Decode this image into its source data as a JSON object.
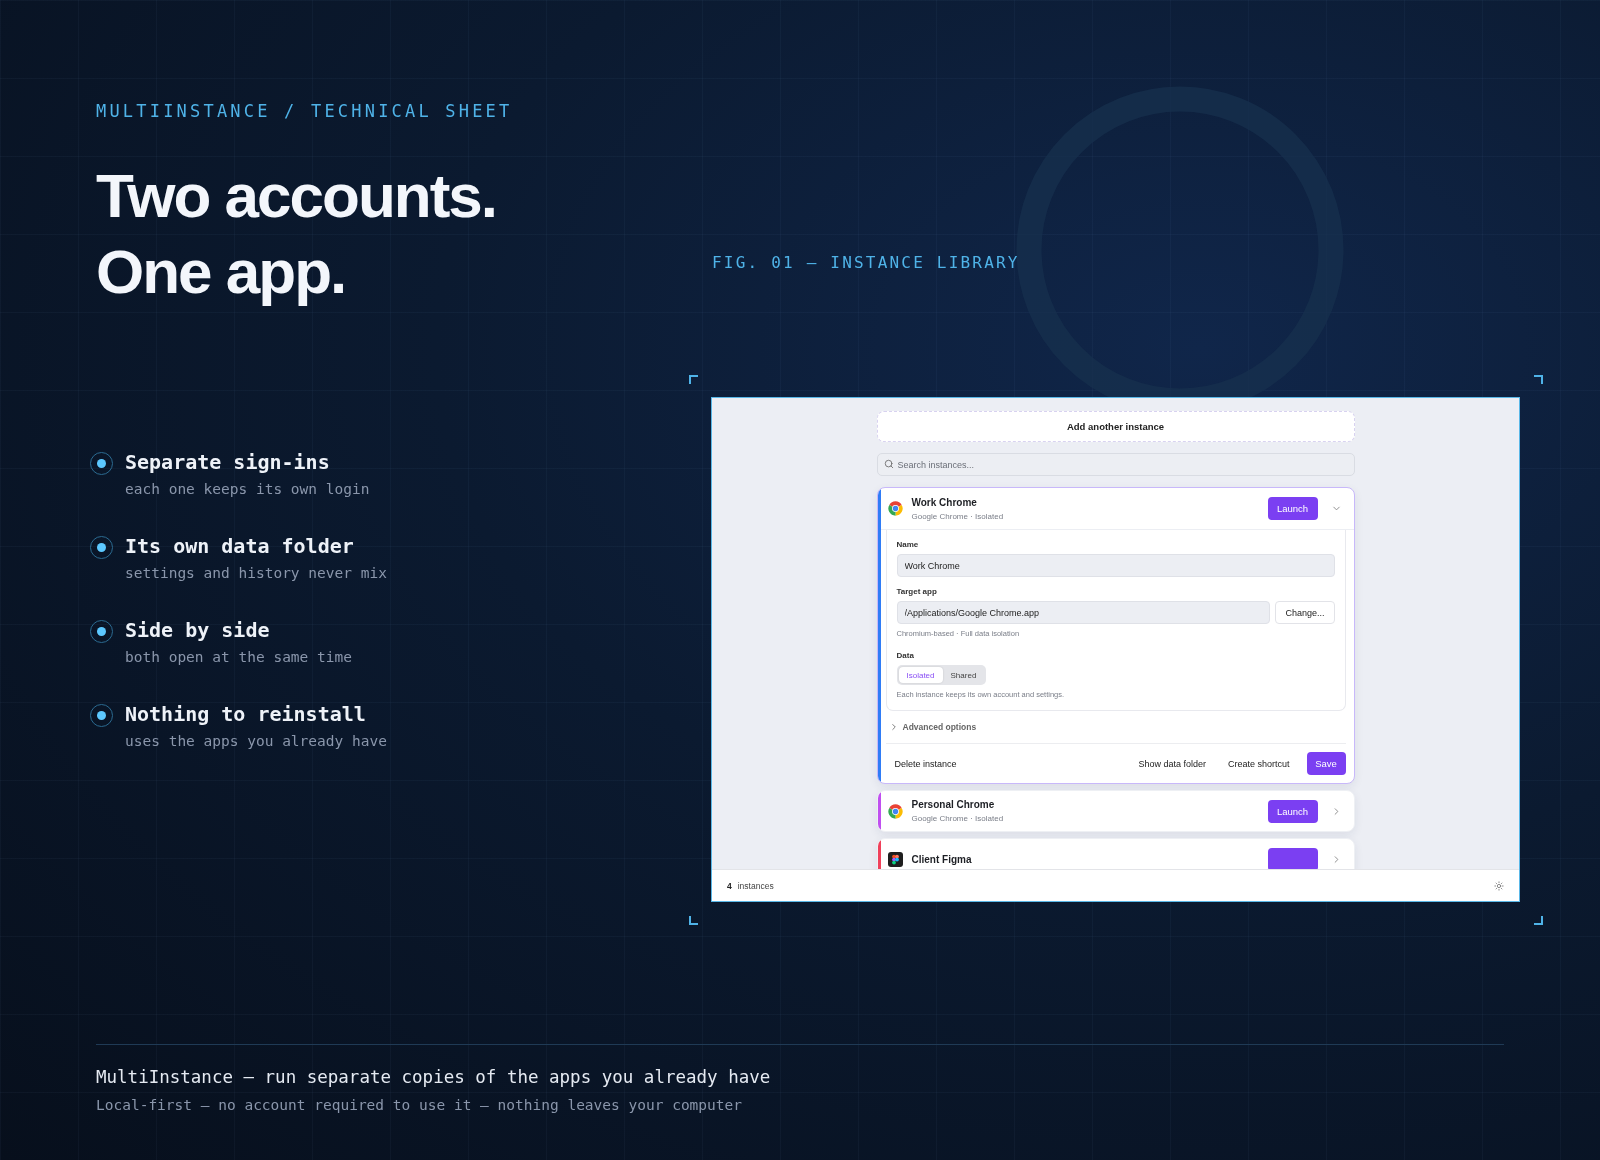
{
  "eyebrow": "MULTIINSTANCE / TECHNICAL SHEET",
  "heading": [
    "Two accounts.",
    "One app."
  ],
  "features": [
    {
      "title": "Separate sign-ins",
      "subtitle": "each one keeps its own login"
    },
    {
      "title": "Its own data folder",
      "subtitle": "settings and history never mix"
    },
    {
      "title": "Side by side",
      "subtitle": "both open at the same time"
    },
    {
      "title": "Nothing to reinstall",
      "subtitle": "uses the apps you already have"
    }
  ],
  "figure_label": "FIG. 01 — INSTANCE LIBRARY",
  "app": {
    "add_button": "Add another instance",
    "search": {
      "placeholder": "Search instances..."
    },
    "instances": [
      {
        "name": "Work Chrome",
        "subtitle": "Google Chrome · Isolated",
        "color": "#2f7cf6",
        "kind": "chrome",
        "launch": "Launch",
        "expanded": true,
        "details": {
          "name_label": "Name",
          "name_value": "Work Chrome",
          "target_label": "Target app",
          "target_value": "/Applications/Google Chrome.app",
          "change_button": "Change...",
          "target_hint": "Chromium-based · Full data isolation",
          "data_label": "Data",
          "data_options": [
            {
              "label": "Isolated",
              "selected": true
            },
            {
              "label": "Shared",
              "selected": false
            }
          ],
          "data_hint": "Each instance keeps its own account and settings.",
          "advanced": {
            "label": "Advanced options",
            "expanded": false
          },
          "delete_button": "Delete instance",
          "actions": [
            "Show data folder",
            "Create shortcut"
          ],
          "save_button": "Save"
        }
      },
      {
        "name": "Personal Chrome",
        "subtitle": "Google Chrome · Isolated",
        "color": "#c04ff0",
        "kind": "chrome",
        "launch": "Launch",
        "expanded": false
      },
      {
        "name": "Client Figma",
        "color": "#f0405a",
        "kind": "figma",
        "expanded": false
      }
    ],
    "status": {
      "count": "4",
      "label": "instances"
    }
  },
  "footer": {
    "title": "MultiInstance — run separate copies of the apps you already have",
    "subtitle": "Local-first — no account required to use it — nothing leaves your computer"
  }
}
